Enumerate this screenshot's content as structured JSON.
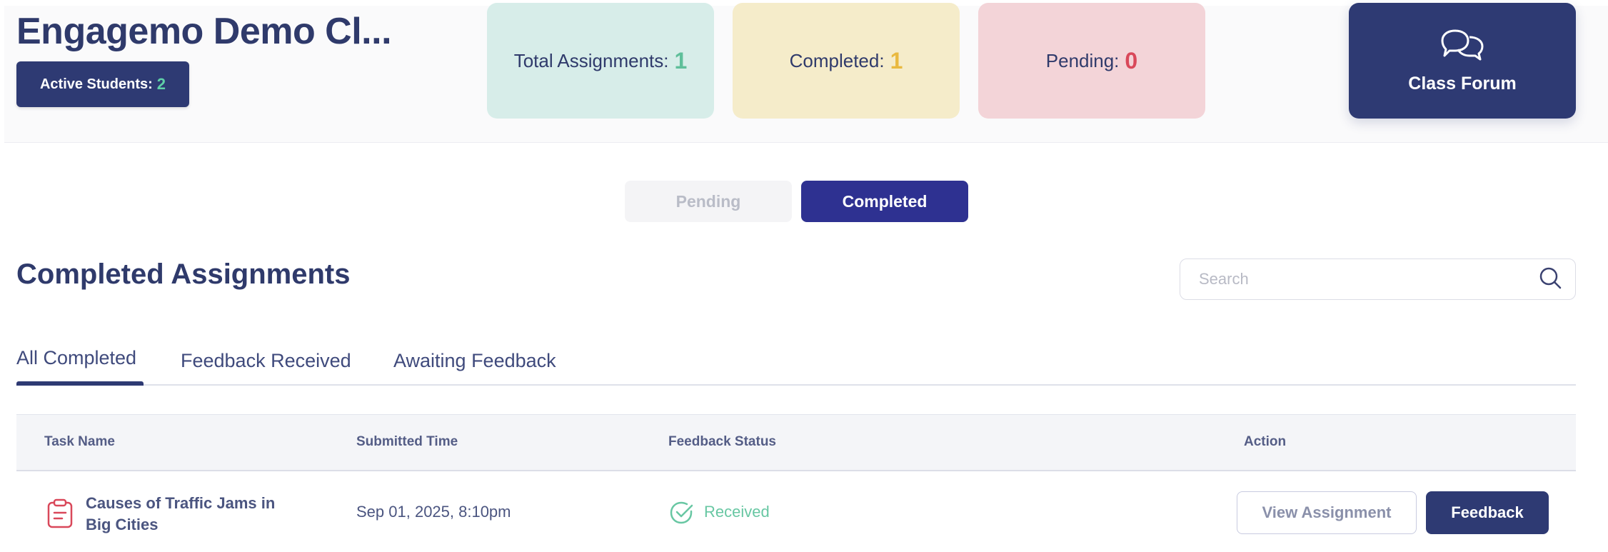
{
  "header": {
    "class_title": "Engagemo Demo Cl...",
    "active_students_label": "Active Students:",
    "active_students_count": "2"
  },
  "stats": {
    "total_label": "Total Assignments:",
    "total_value": "1",
    "completed_label": "Completed:",
    "completed_value": "1",
    "pending_label": "Pending:",
    "pending_value": "0"
  },
  "forum": {
    "label": "Class Forum",
    "icon": "chat-bubbles-icon"
  },
  "toggle": {
    "pending_label": "Pending",
    "completed_label": "Completed",
    "active": "Completed"
  },
  "section": {
    "title": "Completed Assignments"
  },
  "search": {
    "placeholder": "Search",
    "value": ""
  },
  "tabs": [
    {
      "label": "All Completed",
      "active": true
    },
    {
      "label": "Feedback Received",
      "active": false
    },
    {
      "label": "Awaiting Feedback",
      "active": false
    }
  ],
  "table": {
    "columns": [
      "Task Name",
      "Submitted Time",
      "Feedback Status",
      "Action"
    ],
    "rows": [
      {
        "task_name": "Causes of Traffic Jams in Big Cities",
        "submitted_time": "Sep 01, 2025, 8:10pm",
        "feedback_status": "Received",
        "view_label": "View Assignment",
        "feedback_label": "Feedback"
      }
    ]
  },
  "colors": {
    "primary": "#2e3a73",
    "toggle_active": "#2e3191",
    "total_card": "#d7ede9",
    "completed_card": "#f5ecca",
    "pending_card": "#f3d4d8",
    "received_green": "#68c7a3",
    "task_icon_red": "#d9485a"
  }
}
